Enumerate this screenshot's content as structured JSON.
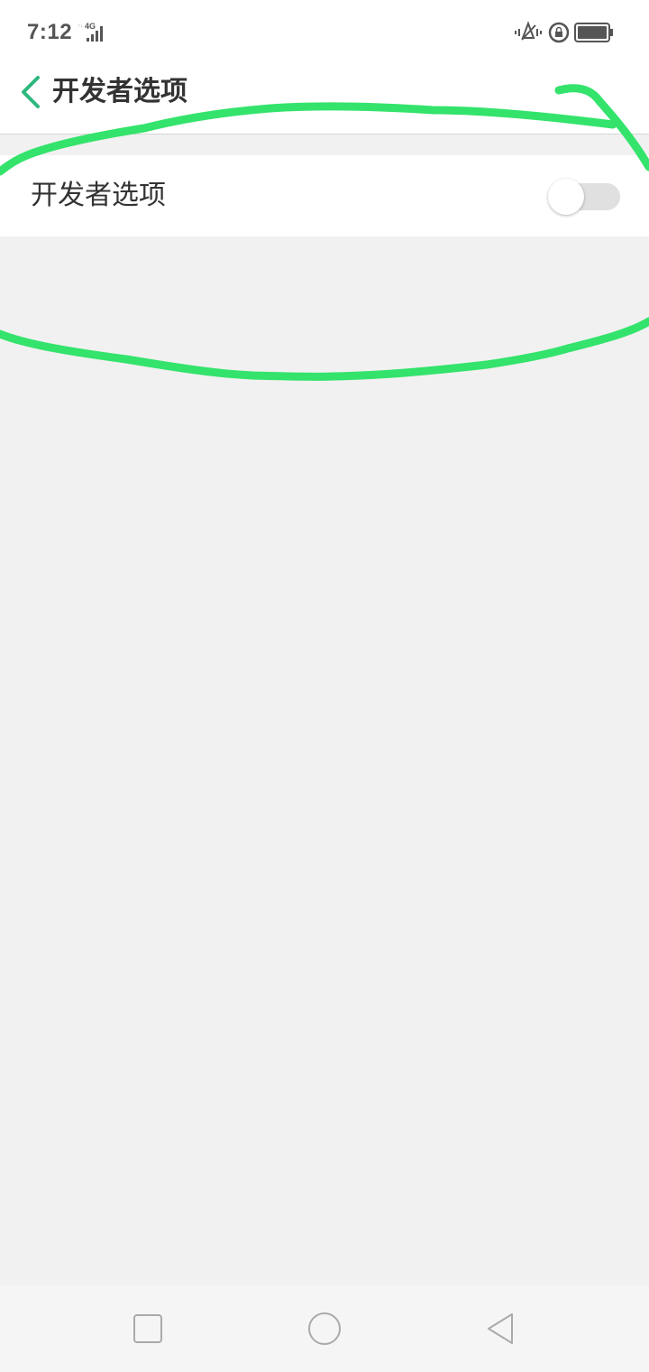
{
  "status_bar": {
    "time": "7:12",
    "network": "4G",
    "icons": [
      "signal-icon",
      "vibrate-icon",
      "rotation-lock-icon",
      "battery-icon"
    ]
  },
  "header": {
    "title": "开发者选项",
    "back_icon": "chevron-left-icon",
    "accent_color": "#2db87d"
  },
  "setting": {
    "label": "开发者选项",
    "toggle_on": false
  },
  "nav_bar": {
    "icons": [
      "recents-square-icon",
      "home-circle-icon",
      "back-triangle-icon"
    ]
  },
  "annotation": {
    "color": "#33e36b"
  }
}
